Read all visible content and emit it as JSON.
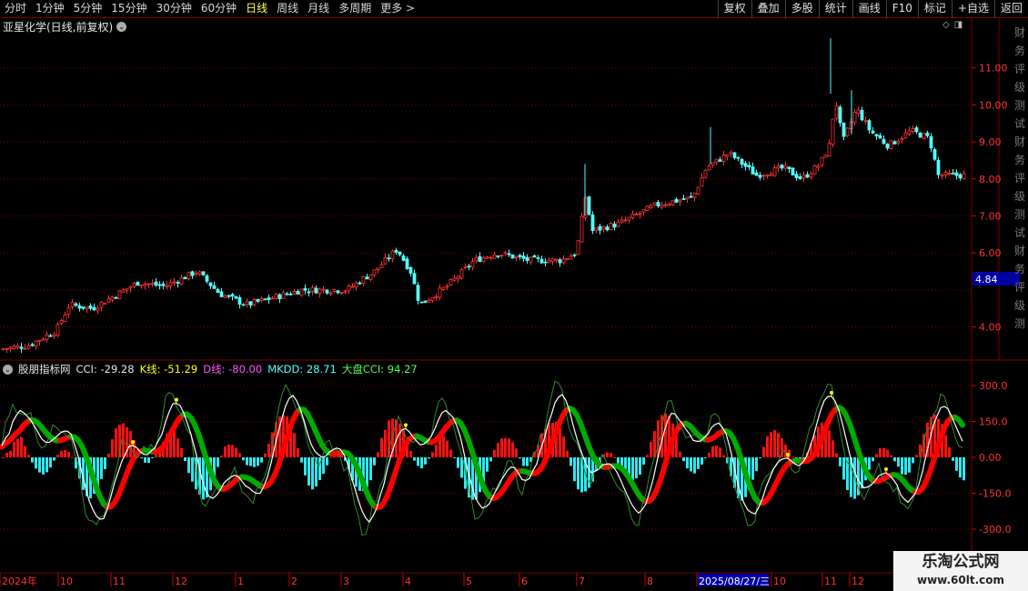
{
  "toolbar": {
    "periods": [
      "分时",
      "1分钟",
      "5分钟",
      "15分钟",
      "30分钟",
      "60分钟",
      "日线",
      "周线",
      "月线",
      "多周期",
      "更多 >"
    ],
    "active_period": "日线",
    "actions": [
      "复权",
      "叠加",
      "多股",
      "统计",
      "画线",
      "F10",
      "标记",
      "+自选",
      "返回"
    ]
  },
  "chart": {
    "title": "亚星化学(日线,前复权)",
    "price_ticks": [
      "11.00",
      "10.00",
      "9.00",
      "8.00",
      "7.00",
      "6.00",
      "4.00"
    ],
    "current_price_label": "4.84",
    "side_text": "财务评级测试"
  },
  "indicator": {
    "name": "股朋指标网",
    "cci_label": "CCI: -29.28",
    "k_label": "K线: -51.29",
    "d_label": "D线: -80.00",
    "mkdd_label": "MKDD: 28.71",
    "dapan_label": "大盘CCI: 94.27",
    "ticks": [
      "300.0",
      "150.0",
      "0.00",
      "-150.0",
      "-300.0"
    ]
  },
  "date_axis": {
    "labels": [
      "2024年",
      "10",
      "11",
      "12",
      "1",
      "2",
      "3",
      "4",
      "5",
      "6",
      "7",
      "8",
      "2025/08/27/三",
      "10",
      "11",
      "12"
    ]
  },
  "watermark": {
    "line1": "乐淘公式网",
    "line2": "www.60lt.com"
  },
  "colors": {
    "up": "#ff3232",
    "down": "#54fcfc",
    "grid": "#7a0000",
    "k_line": "#ffffff",
    "d_band_up": "#ff0000",
    "d_band_down": "#00aa00",
    "cci_line": "#2f8a2f",
    "marker": "#ffff00",
    "label_bg": "#0000a0"
  },
  "icons": {
    "title_dropdown": "chevron-down-icon",
    "diamond": "diamond-icon",
    "panel_toggle": "panel-toggle-icon",
    "indicator_dropdown": "chevron-down-icon"
  }
}
